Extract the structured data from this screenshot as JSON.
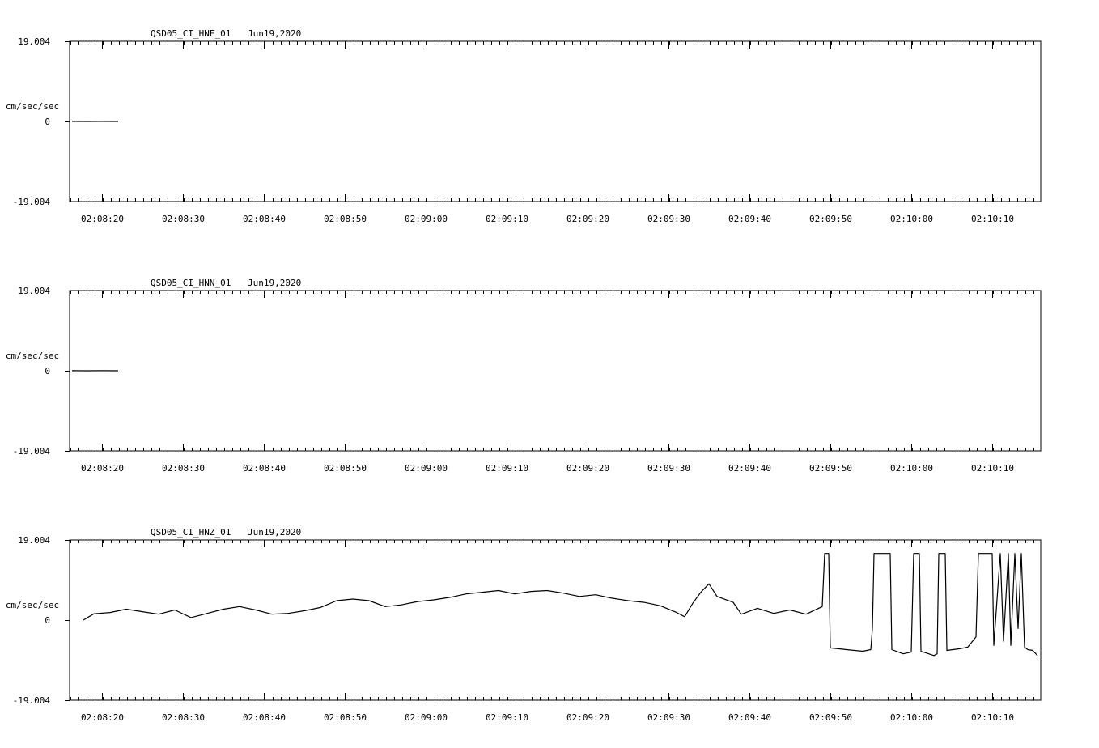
{
  "chart_data": [
    {
      "type": "line",
      "title": "QSD05_CI_HNE_01",
      "date": "Jun19,2020",
      "ylabel": "cm/sec/sec",
      "ylim": [
        -19.004,
        19.004
      ],
      "yticks": [
        "19.004",
        "0",
        "-19.004"
      ],
      "x_range": [
        "02:08:16",
        "02:10:16"
      ],
      "xticks": [
        "02:08:20",
        "02:08:30",
        "02:08:40",
        "02:08:50",
        "02:09:00",
        "02:09:10",
        "02:09:20",
        "02:09:30",
        "02:09:40",
        "02:09:50",
        "02:10:00",
        "02:10:10"
      ],
      "grid": false,
      "series": [
        {
          "values": [
            [
              0.3,
              0.02
            ],
            [
              2.0,
              0.0
            ],
            [
              4.0,
              0.02
            ],
            [
              6.0,
              0.0
            ]
          ]
        }
      ]
    },
    {
      "type": "line",
      "title": "QSD05_CI_HNN_01",
      "date": "Jun19,2020",
      "ylabel": "cm/sec/sec",
      "ylim": [
        -19.004,
        19.004
      ],
      "yticks": [
        "19.004",
        "0",
        "-19.004"
      ],
      "x_range": [
        "02:08:16",
        "02:10:16"
      ],
      "xticks": [
        "02:08:20",
        "02:08:30",
        "02:08:40",
        "02:08:50",
        "02:09:00",
        "02:09:10",
        "02:09:20",
        "02:09:30",
        "02:09:40",
        "02:09:50",
        "02:10:00",
        "02:10:10"
      ],
      "grid": false,
      "series": [
        {
          "values": [
            [
              0.3,
              0.02
            ],
            [
              2.0,
              0.0
            ],
            [
              4.0,
              0.02
            ],
            [
              6.0,
              0.0
            ]
          ]
        }
      ]
    },
    {
      "type": "line",
      "title": "QSD05_CI_HNZ_01",
      "date": "Jun19,2020",
      "ylabel": "cm/sec/sec",
      "ylim": [
        -19.004,
        19.004
      ],
      "yticks": [
        "19.004",
        "0",
        "-19.004"
      ],
      "x_range": [
        "02:08:16",
        "02:10:16"
      ],
      "xticks": [
        "02:08:20",
        "02:08:30",
        "02:08:40",
        "02:08:50",
        "02:09:00",
        "02:09:10",
        "02:09:20",
        "02:09:30",
        "02:09:40",
        "02:09:50",
        "02:10:00",
        "02:10:10"
      ],
      "grid": false,
      "series": [
        {
          "values": [
            [
              1.7,
              0.0
            ],
            [
              3.0,
              1.5
            ],
            [
              5.0,
              1.8
            ],
            [
              7.0,
              2.6
            ],
            [
              9.0,
              2.0
            ],
            [
              11.0,
              1.4
            ],
            [
              13.0,
              2.4
            ],
            [
              15.0,
              0.6
            ],
            [
              17.0,
              1.6
            ],
            [
              19.0,
              2.6
            ],
            [
              21.0,
              3.2
            ],
            [
              23.0,
              2.4
            ],
            [
              25.0,
              1.4
            ],
            [
              27.0,
              1.6
            ],
            [
              29.0,
              2.2
            ],
            [
              31.0,
              3.0
            ],
            [
              33.0,
              4.6
            ],
            [
              35.0,
              5.0
            ],
            [
              37.0,
              4.6
            ],
            [
              39.0,
              3.2
            ],
            [
              41.0,
              3.6
            ],
            [
              43.0,
              4.4
            ],
            [
              45.0,
              4.8
            ],
            [
              47.0,
              5.4
            ],
            [
              49.0,
              6.2
            ],
            [
              51.0,
              6.6
            ],
            [
              53.0,
              7.0
            ],
            [
              55.0,
              6.2
            ],
            [
              57.0,
              6.8
            ],
            [
              59.0,
              7.0
            ],
            [
              61.0,
              6.4
            ],
            [
              63.0,
              5.6
            ],
            [
              65.0,
              6.0
            ],
            [
              67.0,
              5.2
            ],
            [
              69.0,
              4.6
            ],
            [
              71.0,
              4.2
            ],
            [
              73.0,
              3.4
            ],
            [
              75.0,
              1.8
            ],
            [
              76.0,
              0.8
            ],
            [
              77.0,
              4.0
            ],
            [
              78.0,
              6.6
            ],
            [
              79.0,
              8.6
            ],
            [
              80.0,
              5.6
            ],
            [
              82.0,
              4.2
            ],
            [
              83.0,
              1.4
            ],
            [
              85.0,
              2.8
            ],
            [
              87.0,
              1.6
            ],
            [
              89.0,
              2.4
            ],
            [
              91.0,
              1.4
            ],
            [
              93.0,
              3.2
            ],
            [
              93.3,
              15.8
            ],
            [
              93.8,
              15.8
            ],
            [
              94.0,
              -6.6
            ],
            [
              96.0,
              -7.0
            ],
            [
              98.0,
              -7.4
            ],
            [
              99.0,
              -7.0
            ],
            [
              99.2,
              -2.0
            ],
            [
              99.4,
              15.8
            ],
            [
              101.0,
              15.8
            ],
            [
              101.4,
              15.8
            ],
            [
              101.6,
              -7.0
            ],
            [
              103.0,
              -8.0
            ],
            [
              104.0,
              -7.6
            ],
            [
              104.3,
              15.8
            ],
            [
              105.0,
              15.8
            ],
            [
              105.2,
              -7.4
            ],
            [
              106.8,
              -8.4
            ],
            [
              107.2,
              -8.0
            ],
            [
              107.4,
              15.8
            ],
            [
              107.8,
              15.8
            ],
            [
              108.2,
              15.8
            ],
            [
              108.4,
              -7.2
            ],
            [
              110.0,
              -6.8
            ],
            [
              111.0,
              -6.4
            ],
            [
              112.0,
              -4.0
            ],
            [
              112.3,
              15.8
            ],
            [
              113.0,
              15.8
            ],
            [
              114.0,
              15.8
            ],
            [
              114.2,
              -6.0
            ],
            [
              115.0,
              15.8
            ],
            [
              115.4,
              -5.0
            ],
            [
              116.0,
              15.8
            ],
            [
              116.3,
              -6.0
            ],
            [
              116.8,
              15.8
            ],
            [
              117.2,
              -2.0
            ],
            [
              117.6,
              15.8
            ],
            [
              118.0,
              -6.4
            ],
            [
              118.4,
              -7.0
            ],
            [
              119.0,
              -7.2
            ],
            [
              119.6,
              -8.4
            ]
          ]
        }
      ]
    }
  ]
}
